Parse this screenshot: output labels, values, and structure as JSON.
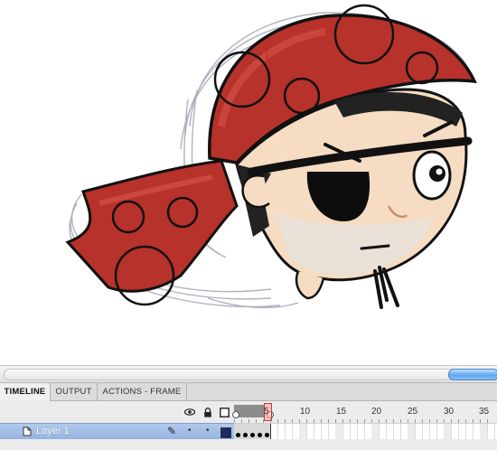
{
  "tabs": [
    "TIMELINE",
    "OUTPUT",
    "ACTIONS - FRAME"
  ],
  "active_tab": "TIMELINE",
  "timeline": {
    "ruler_labels": [
      "5",
      "10",
      "15",
      "20",
      "25",
      "30",
      "35"
    ],
    "current_frame": 5,
    "keyframe_count": 5
  },
  "layer": {
    "name": "Layer 1",
    "color": "#1a2a66"
  },
  "icons": {
    "visibility": "eye-icon",
    "lock": "lock-icon",
    "outline": "outline-square-icon",
    "edit": "pencil-icon",
    "layer": "layer-page-icon"
  },
  "colors": {
    "bandana": "#b7322a",
    "skin": "#f5dcc2",
    "selected_layer": "#9bb8e3",
    "playhead": "#cc2222",
    "scroll_thumb": "#5fa6ec"
  }
}
